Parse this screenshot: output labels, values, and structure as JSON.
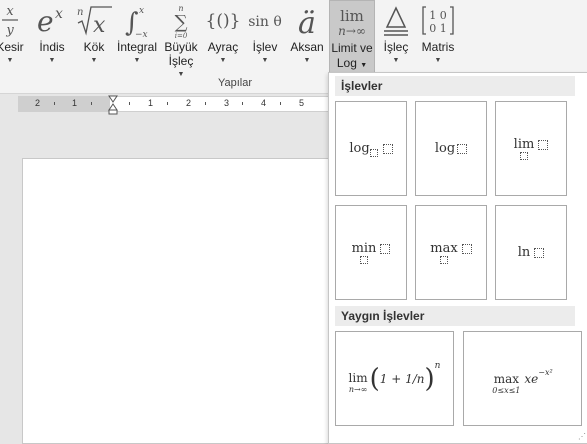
{
  "ribbon": {
    "buttons": [
      {
        "id": "kesir",
        "label": "Kesir",
        "label2": ""
      },
      {
        "id": "indis",
        "label": "İndis",
        "label2": ""
      },
      {
        "id": "kok",
        "label": "Kök",
        "label2": ""
      },
      {
        "id": "integral",
        "label": "İntegral",
        "label2": ""
      },
      {
        "id": "buyuk-islec",
        "label": "Büyük",
        "label2": "İşleç"
      },
      {
        "id": "ayrac",
        "label": "Ayraç",
        "label2": ""
      },
      {
        "id": "islev",
        "label": "İşlev",
        "label2": ""
      },
      {
        "id": "aksan",
        "label": "Aksan",
        "label2": ""
      },
      {
        "id": "limit-log",
        "label": "Limit ve",
        "label2": "Log"
      },
      {
        "id": "islec",
        "label": "İşleç",
        "label2": ""
      },
      {
        "id": "matris",
        "label": "Matris",
        "label2": ""
      }
    ],
    "group_label": "Yapılar"
  },
  "ruler": {
    "numbers_left": [
      "2",
      "1"
    ],
    "numbers_right": [
      "1",
      "2",
      "3",
      "4",
      "5"
    ]
  },
  "dropdown": {
    "section1_title": "İşlevler",
    "section2_title": "Yaygın İşlevler",
    "functions": [
      {
        "name": "log",
        "type": "sub"
      },
      {
        "name": "log",
        "type": "plain"
      },
      {
        "name": "lim",
        "type": "under"
      },
      {
        "name": "min",
        "type": "under"
      },
      {
        "name": "max",
        "type": "under"
      },
      {
        "name": "ln",
        "type": "plain"
      }
    ],
    "common": {
      "item1": {
        "op": "lim",
        "sub": "n→∞",
        "body": "1 + 1/n",
        "exp": "n"
      },
      "item2": {
        "op": "max",
        "sub": "0≤x≤1",
        "body": "xe",
        "exp": "−x²"
      }
    }
  }
}
